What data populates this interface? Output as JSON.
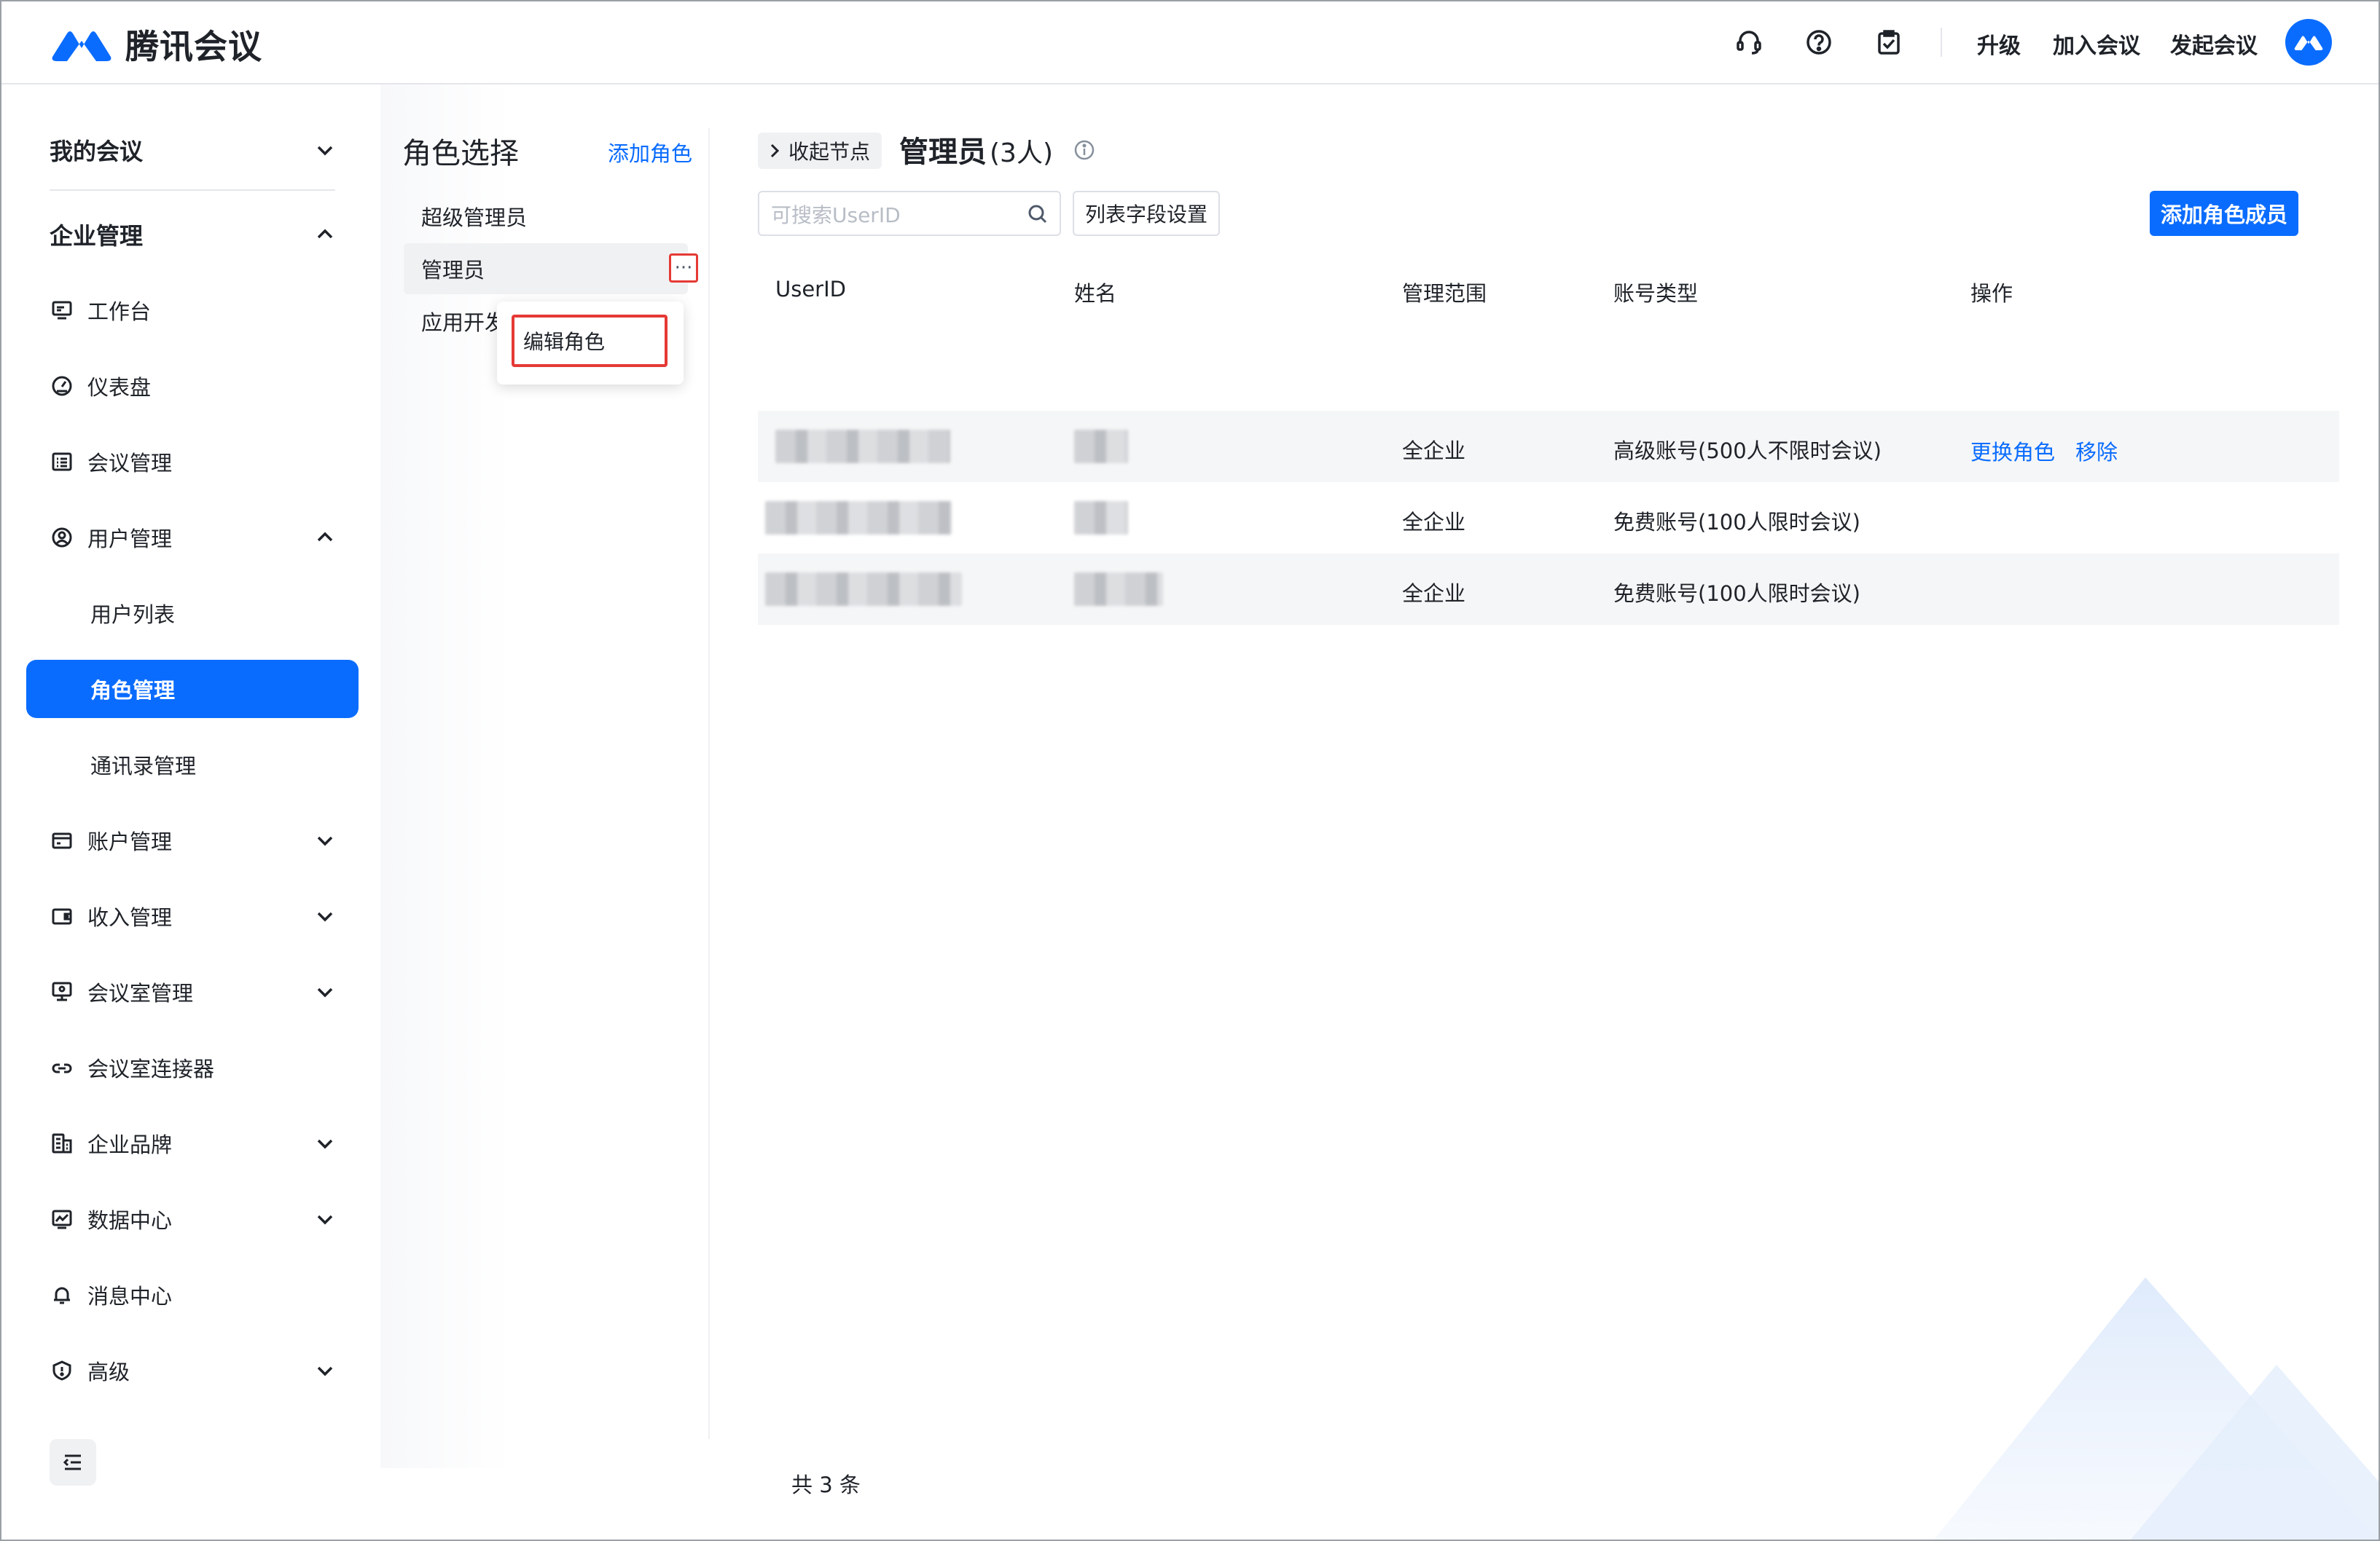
{
  "header": {
    "brand": "腾讯会议",
    "links": {
      "upgrade": "升级",
      "join": "加入会议",
      "start": "发起会议"
    },
    "icons": [
      "headset-icon",
      "help-icon",
      "clipboard-icon"
    ]
  },
  "sidebar": {
    "my_meetings": "我的会议",
    "enterprise": "企业管理",
    "items": {
      "workbench": "工作台",
      "dashboard": "仪表盘",
      "meeting_mgmt": "会议管理",
      "user_mgmt": "用户管理",
      "user_list": "用户列表",
      "role_mgmt": "角色管理",
      "contacts_mgmt": "通讯录管理",
      "account_mgmt": "账户管理",
      "income_mgmt": "收入管理",
      "room_mgmt": "会议室管理",
      "room_connector": "会议室连接器",
      "brand": "企业品牌",
      "data_center": "数据中心",
      "message_center": "消息中心",
      "advanced": "高级"
    }
  },
  "roles": {
    "title": "角色选择",
    "add_label": "添加角色",
    "list": [
      "超级管理员",
      "管理员",
      "应用开发"
    ],
    "menu": {
      "edit": "编辑角色"
    }
  },
  "main": {
    "collapse_label": "收起节点",
    "title": "管理员",
    "count": "(3人)",
    "search_placeholder": "可搜索UserID",
    "column_settings": "列表字段设置",
    "add_member": "添加角色成员",
    "columns": [
      "UserID",
      "姓名",
      "管理范围",
      "账号类型",
      "操作"
    ],
    "rows": [
      {
        "scope": "全企业",
        "account_type": "高级账号(500人不限时会议)",
        "actions": [
          "更换角色",
          "移除"
        ]
      },
      {
        "scope": "全企业",
        "account_type": "免费账号(100人限时会议)",
        "actions": []
      },
      {
        "scope": "全企业",
        "account_type": "免费账号(100人限时会议)",
        "actions": []
      }
    ],
    "total": "共 3 条"
  },
  "colors": {
    "accent": "#0a6cff",
    "highlight": "#e53935"
  }
}
